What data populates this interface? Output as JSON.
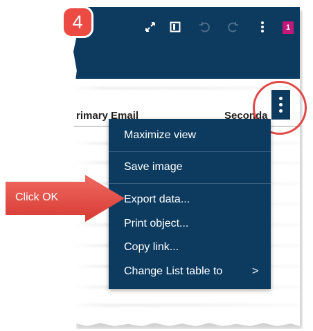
{
  "step_badge": "4",
  "toolbar": {
    "maximize_icon": "expand-arrows-icon",
    "panel_icon": "panel-toggle-icon",
    "undo_icon": "undo-icon",
    "redo_icon": "redo-icon",
    "more_icon": "more-vertical-icon",
    "badge_count": "1",
    "badge_color": "#c2187a"
  },
  "table": {
    "columns": [
      "Primary Email",
      "Seconda"
    ]
  },
  "object_menu_button_icon": "more-vertical-icon",
  "menu": {
    "items": [
      "Maximize view",
      "Save image",
      "Export data...",
      "Print object...",
      "Copy link...",
      "Change List table to"
    ],
    "submenu_arrow": ">"
  },
  "callout": {
    "text": "Click OK",
    "color": "#ec4b43"
  },
  "colors": {
    "header_bg": "#0d3b60",
    "menu_bg": "#0d3b60",
    "highlight": "#e24545"
  }
}
